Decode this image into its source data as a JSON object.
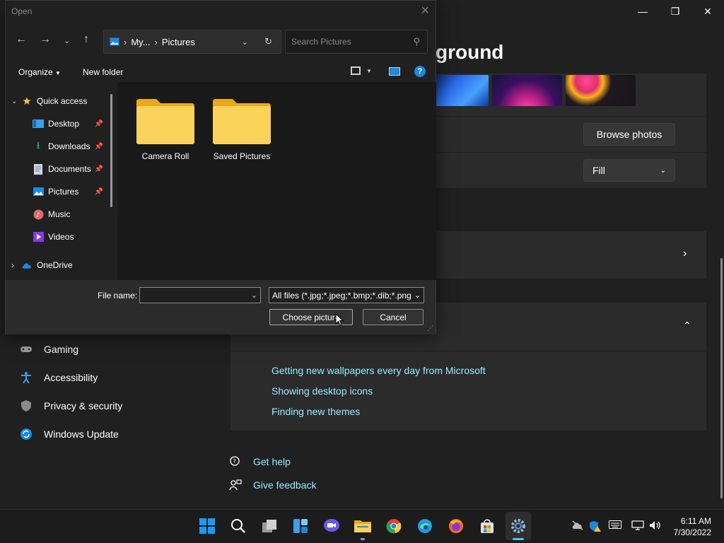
{
  "settings": {
    "title_partial": "ground",
    "window_controls": {
      "minimize": "—",
      "maximize": "❐",
      "close": "✕"
    },
    "browse_label": "Browse photos",
    "fit_value": "Fill",
    "nav": [
      {
        "label": "Gaming"
      },
      {
        "label": "Accessibility"
      },
      {
        "label": "Privacy & security"
      },
      {
        "label": "Windows Update"
      }
    ],
    "related_links": [
      "Getting new wallpapers every day from Microsoft",
      "Showing desktop icons",
      "Finding new themes"
    ],
    "help": {
      "get_help": "Get help",
      "give_feedback": "Give feedback"
    }
  },
  "dialog": {
    "title": "Open",
    "breadcrumb": {
      "parent": "My...",
      "current": "Pictures"
    },
    "search_placeholder": "Search Pictures",
    "organize": "Organize",
    "new_folder": "New folder",
    "tree": {
      "quick_access": "Quick access",
      "items": [
        {
          "label": "Desktop",
          "pinned": true
        },
        {
          "label": "Downloads",
          "pinned": true
        },
        {
          "label": "Documents",
          "pinned": true
        },
        {
          "label": "Pictures",
          "pinned": true
        },
        {
          "label": "Music",
          "pinned": false
        },
        {
          "label": "Videos",
          "pinned": false
        }
      ],
      "onedrive": "OneDrive"
    },
    "folders": [
      "Camera Roll",
      "Saved Pictures"
    ],
    "file_name_label": "File name:",
    "file_name_value": "",
    "file_type": "All files (*.jpg;*.jpeg;*.bmp;*.dib;*.png",
    "choose_label": "Choose picture",
    "cancel_label": "Cancel"
  },
  "taskbar": {
    "time": "6:11 AM",
    "date": "7/30/2022"
  },
  "colors": {
    "accent_link": "#99ebff",
    "folder_yellow": "#f8c93a",
    "windows_blue": "#0f9af4"
  }
}
